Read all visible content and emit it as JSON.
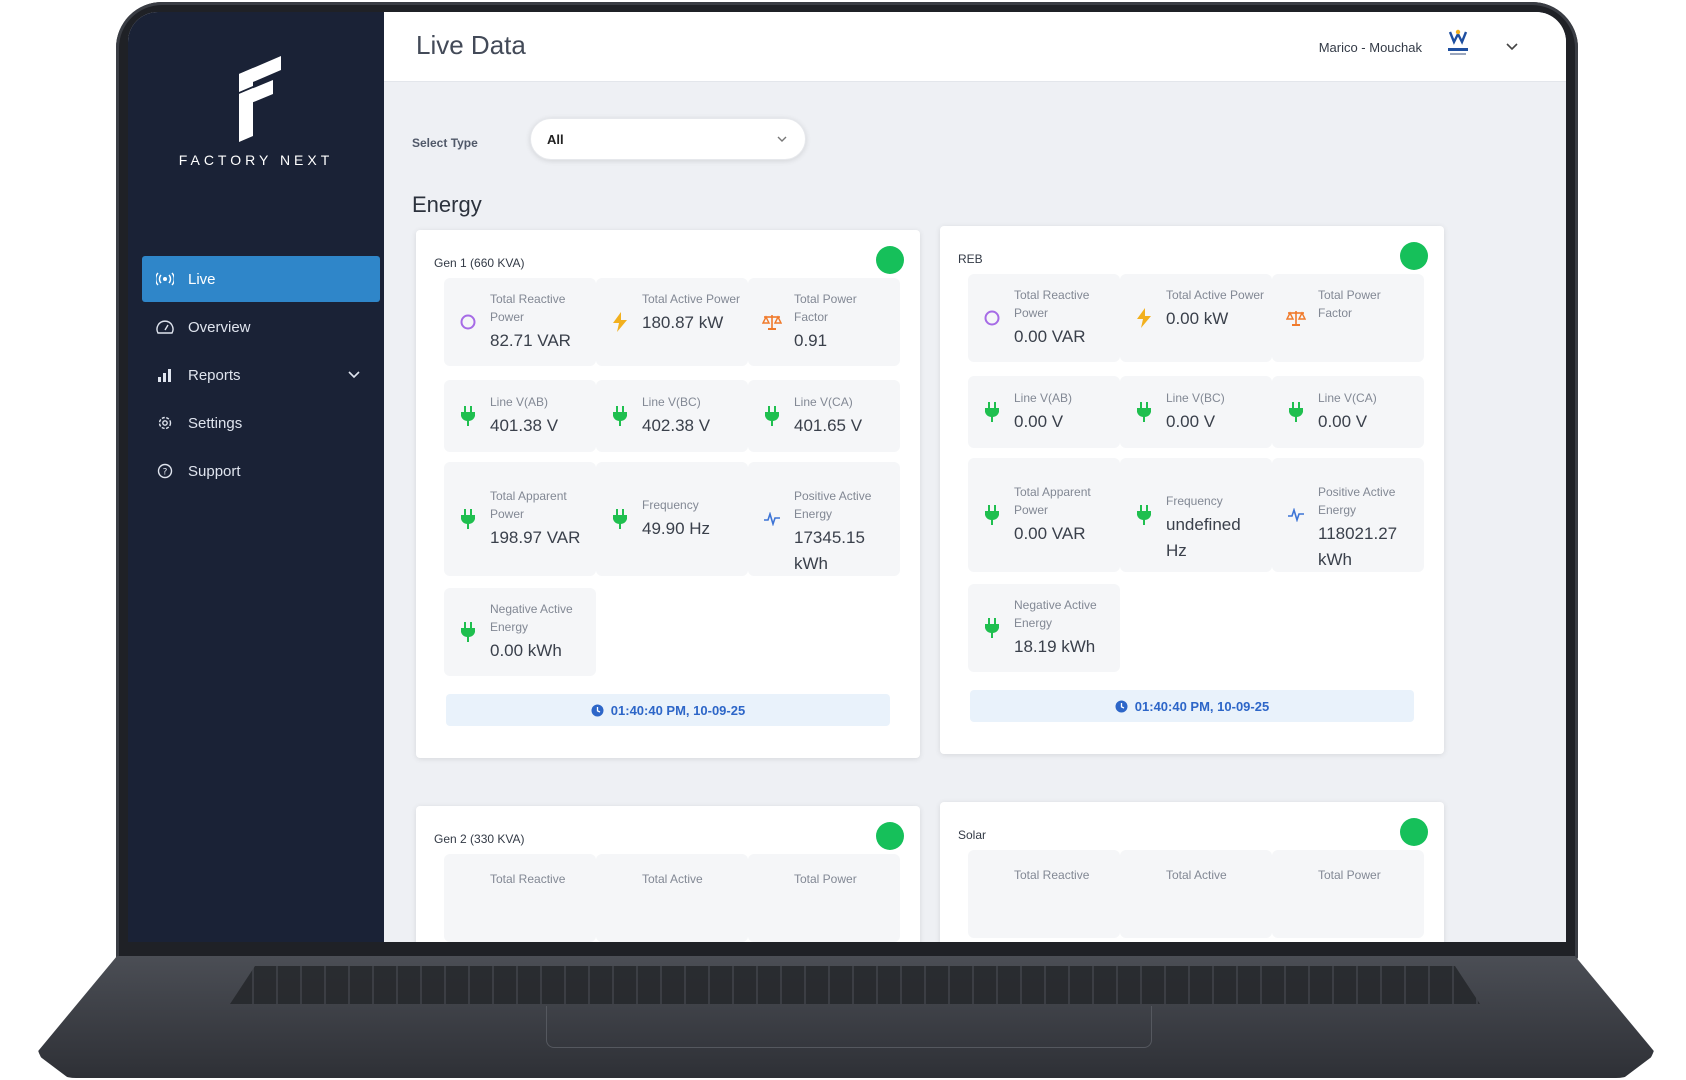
{
  "brand": {
    "name": "FACTORY NEXT"
  },
  "header": {
    "title": "Live Data",
    "user": "Marico - Mouchak"
  },
  "sidebar": {
    "items": [
      {
        "label": "Live",
        "icon": "broadcast-icon",
        "active": true
      },
      {
        "label": "Overview",
        "icon": "gauge-icon"
      },
      {
        "label": "Reports",
        "icon": "bar-chart-icon"
      },
      {
        "label": "Settings",
        "icon": "gear-icon"
      },
      {
        "label": "Support",
        "icon": "help-circle-icon"
      }
    ]
  },
  "filter": {
    "label": "Select Type",
    "value": "All"
  },
  "section": {
    "title": "Energy"
  },
  "colors": {
    "sidebar": "#1a2236",
    "active": "#2f86c9",
    "status": "#16c05a",
    "plug": "#1fbf4f",
    "bolt": "#f2b01e",
    "scale": "#f07a2b",
    "ring": "#a66be6",
    "wave": "#3d74d6"
  },
  "cards": [
    {
      "title": "Gen 1 (660 KVA)",
      "timestamp": "01:40:40 PM, 10-09-25",
      "tiles": [
        {
          "label": "Total Reactive Power",
          "value": "82.71 VAR"
        },
        {
          "label": "Total Active Power",
          "value": "180.87 kW"
        },
        {
          "label": "Total Power Factor",
          "value": "0.91"
        },
        {
          "label": "Line V(AB)",
          "value": "401.38 V"
        },
        {
          "label": "Line V(BC)",
          "value": "402.38 V"
        },
        {
          "label": "Line V(CA)",
          "value": "401.65 V"
        },
        {
          "label": "Total Apparent Power",
          "value": "198.97 VAR"
        },
        {
          "label": "Frequency",
          "value": "49.90 Hz"
        },
        {
          "label": "Positive Active Energy",
          "value": "17345.15 kWh"
        },
        {
          "label": "Negative Active Energy",
          "value": "0.00 kWh"
        }
      ]
    },
    {
      "title": "REB",
      "timestamp": "01:40:40 PM, 10-09-25",
      "tiles": [
        {
          "label": "Total Reactive Power",
          "value": "0.00 VAR"
        },
        {
          "label": "Total Active Power",
          "value": "0.00 kW"
        },
        {
          "label": "Total Power Factor",
          "value": ""
        },
        {
          "label": "Line V(AB)",
          "value": "0.00 V"
        },
        {
          "label": "Line V(BC)",
          "value": "0.00 V"
        },
        {
          "label": "Line V(CA)",
          "value": "0.00 V"
        },
        {
          "label": "Total Apparent Power",
          "value": "0.00 VAR"
        },
        {
          "label": "Frequency",
          "value": "undefined Hz"
        },
        {
          "label": "Positive Active Energy",
          "value": "118021.27 kWh"
        },
        {
          "label": "Negative Active Energy",
          "value": "18.19 kWh"
        }
      ]
    },
    {
      "title": "Gen 2 (330 KVA)",
      "tiles": [
        {
          "label": "Total Reactive"
        },
        {
          "label": "Total Active"
        },
        {
          "label": "Total Power"
        }
      ]
    },
    {
      "title": "Solar",
      "tiles": [
        {
          "label": "Total Reactive"
        },
        {
          "label": "Total Active"
        },
        {
          "label": "Total Power"
        }
      ]
    }
  ]
}
